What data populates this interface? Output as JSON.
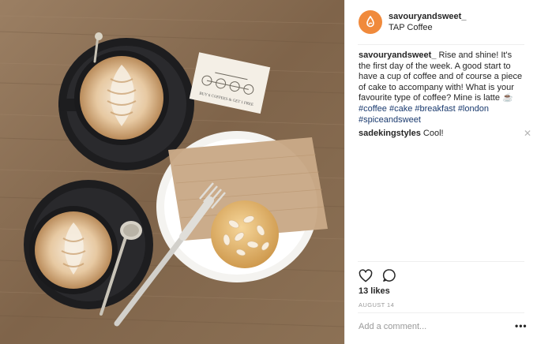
{
  "post": {
    "username": "savouryandsweet_",
    "location": "TAP Coffee",
    "caption_user": "savouryandsweet_",
    "caption_text": " Rise and shine! It's the first day of the week. A good start to have a cup of coffee and of course a piece of cake to accompany with! What is your favourite type of coffee? Mine is latte ☕",
    "hashtags": [
      "#coffee",
      "#cake",
      "#breakfast",
      "#london",
      "#spiceandsweet"
    ],
    "likes": "13 likes",
    "date": "AUGUST 14",
    "add_comment_placeholder": "Add a comment...",
    "more": "•••"
  },
  "comments": [
    {
      "user": "sadekingstyles",
      "text": " Cool!",
      "close": "✕"
    }
  ],
  "photo": {
    "card_text": "BUY 6 COFFEES & GET 1 FREE"
  },
  "colors": {
    "avatar": "#f08a3c",
    "hashtag": "#1a3a6e",
    "table": "#8a6d50",
    "saucer": "#1d1d1f"
  }
}
